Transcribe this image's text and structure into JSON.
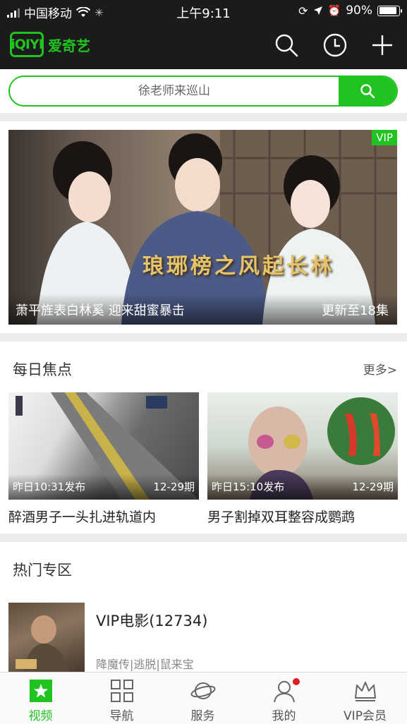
{
  "status_bar": {
    "carrier": "中国移动",
    "time": "上午9:11",
    "battery": "90%"
  },
  "app": {
    "logo_mark": "iQIYI",
    "logo_text": "爱奇艺"
  },
  "search": {
    "placeholder": "徐老师来巡山"
  },
  "banner": {
    "vip_tag": "VIP",
    "caption": "萧平旌表白林奚 迎来甜蜜暴击",
    "update": "更新至18集",
    "art_title": "琅琊榜之风起长林"
  },
  "daily": {
    "title": "每日焦点",
    "more": "更多>",
    "cards": [
      {
        "time": "昨日10:31发布",
        "ep": "12-29期",
        "title": "醉酒男子一头扎进轨道内"
      },
      {
        "time": "昨日15:10发布",
        "ep": "12-29期",
        "title": "男子割掉双耳整容成鹦鹉"
      }
    ]
  },
  "hot": {
    "title": "热门专区",
    "items": [
      {
        "title": "VIP电影(12734)",
        "subtitle": "降魔传|逃脱|鼠来宝"
      }
    ]
  },
  "tabs": [
    {
      "label": "视频",
      "icon": "video-icon",
      "active": true
    },
    {
      "label": "导航",
      "icon": "grid-icon",
      "active": false
    },
    {
      "label": "服务",
      "icon": "planet-icon",
      "active": false
    },
    {
      "label": "我的",
      "icon": "user-icon",
      "active": false
    },
    {
      "label": "VIP会员",
      "icon": "crown-icon",
      "active": false
    }
  ],
  "colors": {
    "brand_green": "#21c320",
    "bar_dark": "#1b1b1b"
  }
}
